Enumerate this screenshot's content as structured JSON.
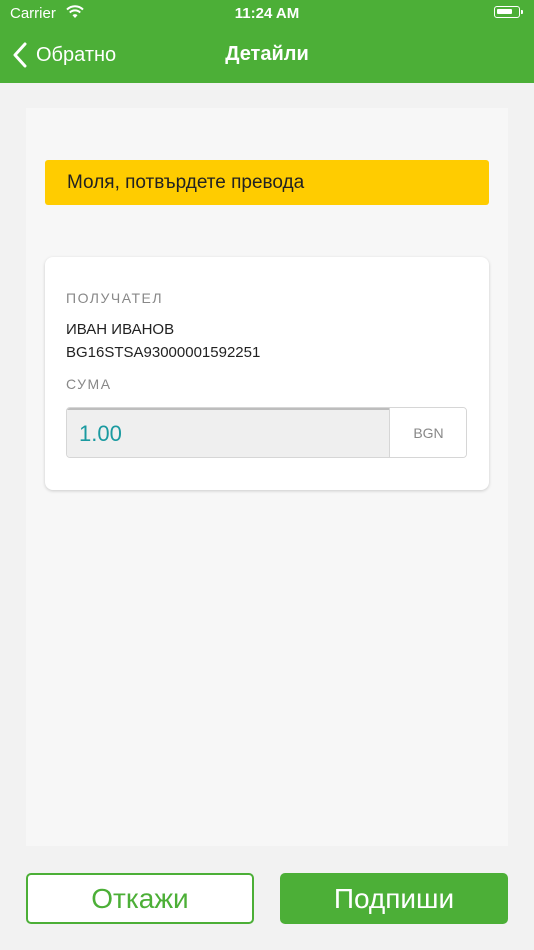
{
  "status_bar": {
    "carrier": "Carrier",
    "time": "11:24 AM"
  },
  "nav": {
    "back_label": "Обратно",
    "title": "Детайли"
  },
  "alert": {
    "message": "Моля, потвърдете превода"
  },
  "transfer": {
    "recipient_label": "ПОЛУЧАТЕЛ",
    "recipient_name": "ИВАН ИВАНОВ",
    "recipient_iban": "BG16STSA93000001592251",
    "amount_label": "СУМА",
    "amount_value": "1.00",
    "currency": "BGN"
  },
  "actions": {
    "cancel_label": "Откажи",
    "sign_label": "Подпиши"
  },
  "colors": {
    "brand_green": "#4caf37",
    "alert_yellow": "#ffcc00",
    "amount_teal": "#1a9aa0"
  },
  "icons": {
    "back": "chevron-left-icon",
    "wifi": "wifi-icon",
    "battery": "battery-icon"
  }
}
